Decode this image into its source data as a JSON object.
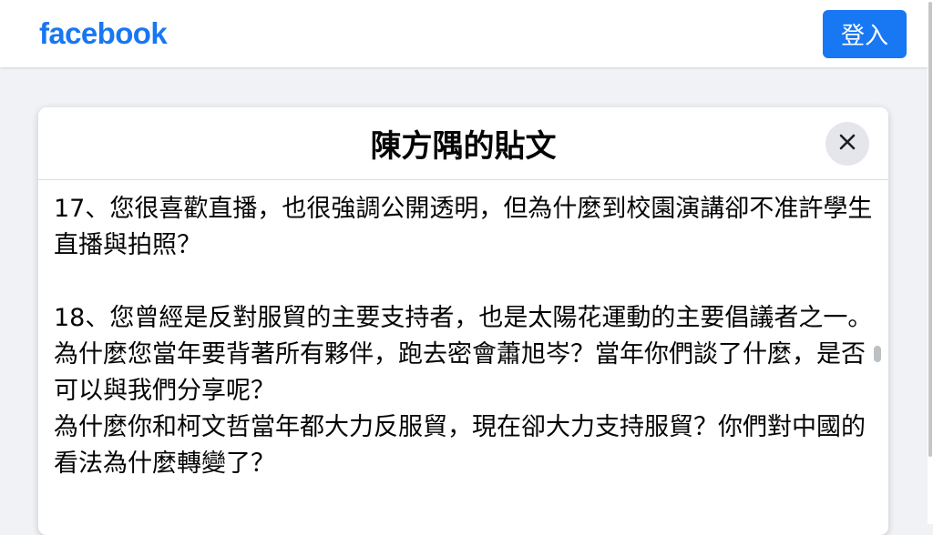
{
  "header": {
    "logo_text": "facebook",
    "login_label": "登入"
  },
  "dialog": {
    "title": "陳方隅的貼文",
    "close_icon": "close-icon",
    "paragraphs": [
      "17、您很喜歡直播，也很強調公開透明，但為什麼到校園演講卻不准許學生直播與拍照？",
      "18、您曾經是反對服貿的主要支持者，也是太陽花運動的主要倡議者之一。為什麼您當年要背著所有夥伴，跑去密會蕭旭岑？當年你們談了什麼，是否可以與我們分享呢？\n為什麼你和柯文哲當年都大力反服貿，現在卻大力支持服貿？你們對中國的看法為什麼轉變了？"
    ]
  },
  "colors": {
    "brand": "#1877f2",
    "background": "#f0f2f5",
    "text": "#050505"
  }
}
